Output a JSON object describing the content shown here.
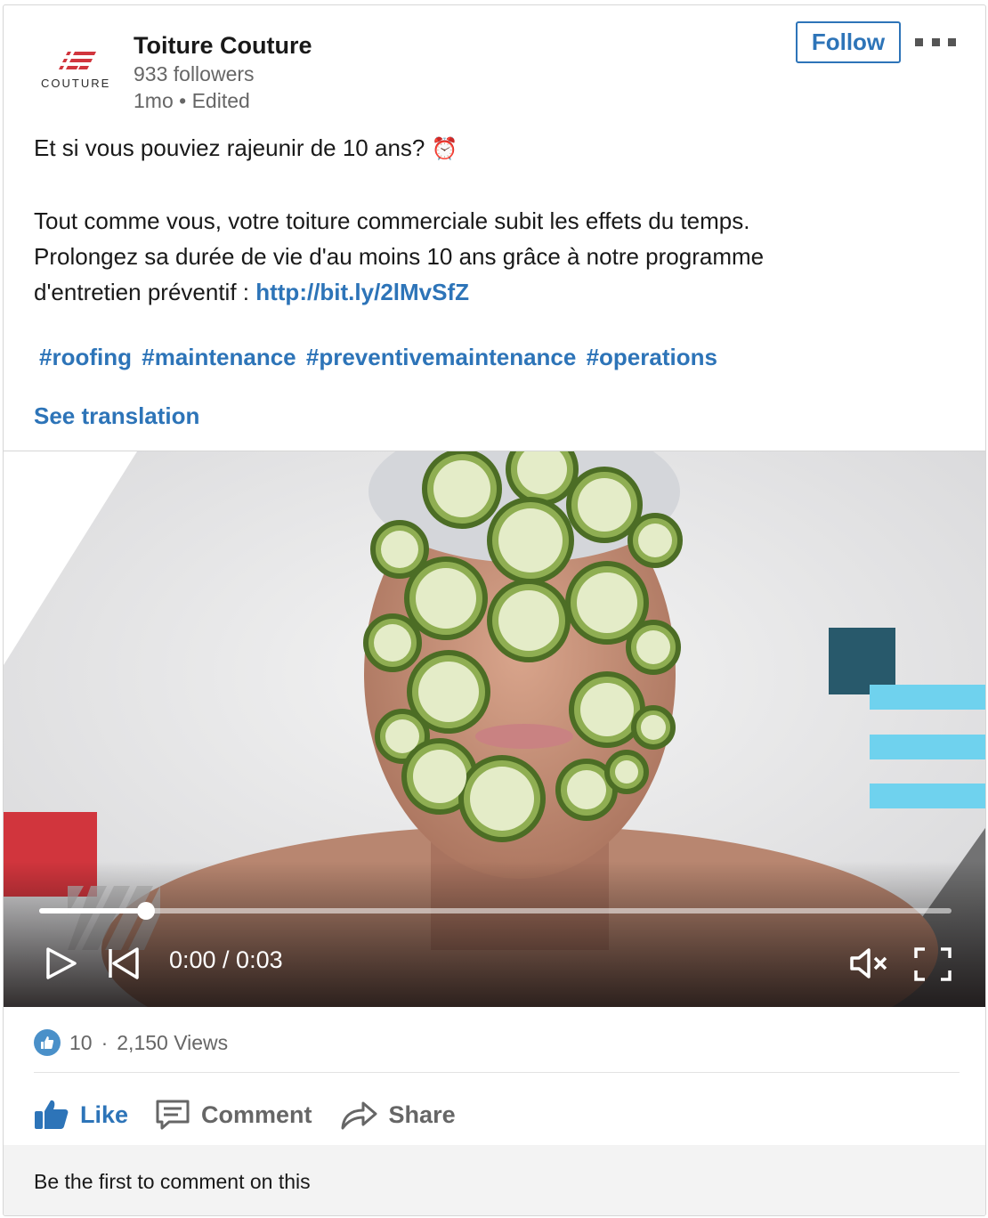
{
  "post": {
    "company": "Toiture Couture",
    "logo_text": "COUTURE",
    "followers": "933 followers",
    "time": "1mo",
    "edited": "Edited",
    "follow_label": "Follow",
    "more_icon": "ellipsis-icon",
    "line1": "Et si vous pouviez rajeunir de 10 ans?",
    "line1_emoji": "⏰",
    "line2": "Tout comme vous, votre toiture commerciale subit les effets du temps.",
    "line3": "Prolongez sa durée de vie d'au moins 10 ans grâce à notre programme",
    "line4_prefix": "d'entretien préventif : ",
    "link": "http://bit.ly/2lMvSfZ",
    "hashtags": [
      "#roofing",
      "#maintenance",
      "#preventivemaintenance",
      "#operations"
    ],
    "see_translation": "See translation"
  },
  "video": {
    "time_display": "0:00 / 0:03",
    "progress": 0.117,
    "muted": true,
    "controls": [
      "play-icon",
      "skip-back-icon",
      "mute-icon",
      "fullscreen-icon"
    ]
  },
  "social": {
    "likes": "10",
    "separator": "·",
    "views": "2,150 Views",
    "actions": {
      "like": "Like",
      "comment": "Comment",
      "share": "Share"
    },
    "comment_prompt": "Be the first to comment on this"
  },
  "colors": {
    "accent": "#2d74b8",
    "brand_red": "#d1353d",
    "teal": "#28596b",
    "cyan": "#6fd2ee"
  }
}
